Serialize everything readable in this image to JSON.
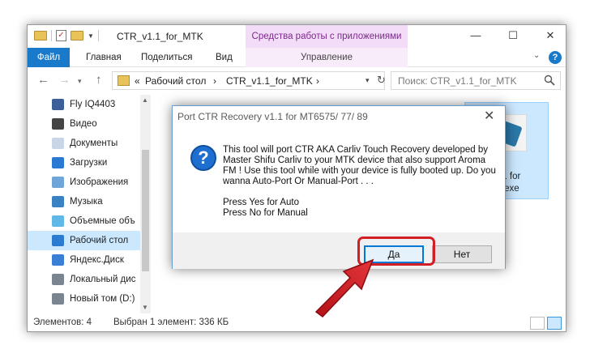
{
  "window": {
    "title": "CTR_v1.1_for_MTK",
    "tools_tab": "Средства работы с приложениями",
    "controls": {
      "minimize": "—",
      "maximize": "☐",
      "close": "✕"
    }
  },
  "ribbon": {
    "tabs": {
      "file": "Файл",
      "home": "Главная",
      "share": "Поделиться",
      "view": "Вид",
      "manage": "Управление"
    },
    "help": "?"
  },
  "address": {
    "crumbs": {
      "prefix": "«",
      "desktop": "Рабочий стол",
      "sep": "›",
      "folder": "CTR_v1.1_for_MTK",
      "sep2": "›"
    },
    "search_placeholder": "Поиск: CTR_v1.1_for_MTK"
  },
  "nav": {
    "items": [
      {
        "label": "Fly IQ4403",
        "icon": "phone-icon",
        "color": "#3c5f99"
      },
      {
        "label": "Видео",
        "icon": "video-icon",
        "color": "#444444"
      },
      {
        "label": "Документы",
        "icon": "documents-icon",
        "color": "#c9d6e8"
      },
      {
        "label": "Загрузки",
        "icon": "downloads-icon",
        "color": "#2a7ad4"
      },
      {
        "label": "Изображения",
        "icon": "pictures-icon",
        "color": "#6fa5d8"
      },
      {
        "label": "Музыка",
        "icon": "music-icon",
        "color": "#3b82c4"
      },
      {
        "label": "Объемные объ",
        "icon": "3d-objects-icon",
        "color": "#5fb8e6"
      },
      {
        "label": "Рабочий стол",
        "icon": "desktop-icon",
        "color": "#2b7bd0"
      },
      {
        "label": "Яндекс.Диск",
        "icon": "yandex-disk-icon",
        "color": "#3a7fd5"
      },
      {
        "label": "Локальный дис",
        "icon": "local-disk-icon",
        "color": "#7a8591"
      },
      {
        "label": "Новый том (D:)",
        "icon": "drive-icon",
        "color": "#7a8591"
      }
    ]
  },
  "content": {
    "file_name_line1": "1.1 for",
    "file_name_line2": "K.exe"
  },
  "status": {
    "count": "Элементов: 4",
    "selected": "Выбран 1 элемент: 336 КБ"
  },
  "dialog": {
    "title": "Port CTR Recovery v1.1 for MT6575/ 77/ 89",
    "close": "✕",
    "message": "This tool will port CTR AKA Carliv Touch Recovery developed by Master Shifu Carliv to your MTK device that also support Aroma FM ! Use this tool while with your device is fully booted up. Do you wanna Auto-Port Or Manual-Port . . .",
    "line_yes": "Press Yes for Auto",
    "line_no": "Press No for Manual",
    "yes": "Да",
    "no": "Нет"
  },
  "colors": {
    "accent": "#1979ca",
    "selection": "#cce8ff",
    "annotation": "#d21f26"
  }
}
